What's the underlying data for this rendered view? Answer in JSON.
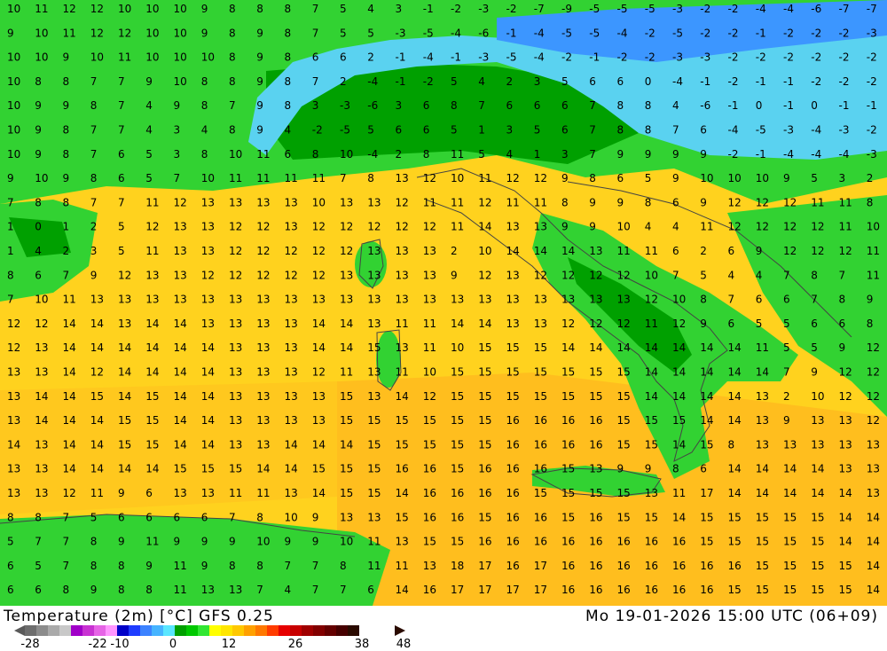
{
  "footer": {
    "title": "Temperature (2m) [°C] GFS 0.25",
    "datetime": "Mo 19-01-2026 15:00 UTC (06+09)",
    "scale_ticks": [
      "-28",
      "-22",
      "-10",
      "0",
      "12",
      "26",
      "38",
      "48"
    ],
    "scale_colors": [
      "#6e6e6e",
      "#8c8c8c",
      "#aaaaaa",
      "#c8c8c8",
      "#a000c8",
      "#c832d2",
      "#e664e6",
      "#ff96ff",
      "#0000c8",
      "#1e3cff",
      "#3c82ff",
      "#46b4ff",
      "#5ae6ff",
      "#00a000",
      "#00c800",
      "#32e632",
      "#ffff00",
      "#ffe600",
      "#ffc800",
      "#ffa000",
      "#ff7800",
      "#ff3c00",
      "#e60000",
      "#c80000",
      "#a00000",
      "#820000",
      "#640000",
      "#460000",
      "#2a0a00"
    ]
  },
  "map_values": [
    [
      "10",
      "11",
      "12",
      "12",
      "10",
      "10",
      "10",
      "9",
      "8",
      "8",
      "8",
      "7",
      "5",
      "4",
      "3",
      "-1",
      "-2",
      "-3",
      "-2",
      "-7",
      "-9",
      "-5",
      "-5",
      "-5",
      "-3",
      "-2",
      "-2",
      "-4",
      "-4",
      "-6",
      "-7",
      "-7"
    ],
    [
      "9",
      "10",
      "11",
      "12",
      "12",
      "10",
      "10",
      "9",
      "8",
      "9",
      "8",
      "7",
      "5",
      "5",
      "-3",
      "-5",
      "-4",
      "-6",
      "-1",
      "-4",
      "-5",
      "-5",
      "-4",
      "-2",
      "-5",
      "-2",
      "-2",
      "-1",
      "-2",
      "-2",
      "-2",
      "-3"
    ],
    [
      "10",
      "10",
      "9",
      "10",
      "11",
      "10",
      "10",
      "10",
      "8",
      "9",
      "8",
      "6",
      "6",
      "2",
      "-1",
      "-4",
      "-1",
      "-3",
      "-5",
      "-4",
      "-2",
      "-1",
      "-2",
      "-2",
      "-3",
      "-3",
      "-2",
      "-2",
      "-2",
      "-2",
      "-2",
      "-2"
    ],
    [
      "10",
      "8",
      "8",
      "7",
      "7",
      "9",
      "10",
      "8",
      "8",
      "9",
      "8",
      "7",
      "2",
      "-4",
      "-1",
      "-2",
      "5",
      "4",
      "2",
      "3",
      "5",
      "6",
      "6",
      "0",
      "-4",
      "-1",
      "-2",
      "-1",
      "-1",
      "-2",
      "-2",
      "-2"
    ],
    [
      "10",
      "9",
      "9",
      "8",
      "7",
      "4",
      "9",
      "8",
      "7",
      "9",
      "8",
      "3",
      "-3",
      "-6",
      "3",
      "6",
      "8",
      "7",
      "6",
      "6",
      "6",
      "7",
      "8",
      "8",
      "4",
      "-6",
      "-1",
      "0",
      "-1",
      "0",
      "-1",
      "-1"
    ],
    [
      "10",
      "9",
      "8",
      "7",
      "7",
      "4",
      "3",
      "4",
      "8",
      "9",
      "4",
      "-2",
      "-5",
      "5",
      "6",
      "6",
      "5",
      "1",
      "3",
      "5",
      "6",
      "7",
      "8",
      "8",
      "7",
      "6",
      "-4",
      "-5",
      "-3",
      "-4",
      "-3",
      "-2"
    ],
    [
      "10",
      "9",
      "8",
      "7",
      "6",
      "5",
      "3",
      "8",
      "10",
      "11",
      "6",
      "8",
      "10",
      "-4",
      "2",
      "8",
      "11",
      "5",
      "4",
      "1",
      "3",
      "7",
      "9",
      "9",
      "9",
      "9",
      "-2",
      "-1",
      "-4",
      "-4",
      "-4",
      "-3"
    ],
    [
      "9",
      "10",
      "9",
      "8",
      "6",
      "5",
      "7",
      "10",
      "11",
      "11",
      "11",
      "11",
      "7",
      "8",
      "13",
      "12",
      "10",
      "11",
      "12",
      "12",
      "9",
      "8",
      "6",
      "5",
      "9",
      "10",
      "10",
      "10",
      "9",
      "5",
      "3",
      "2"
    ],
    [
      "7",
      "8",
      "8",
      "7",
      "7",
      "11",
      "12",
      "13",
      "13",
      "13",
      "13",
      "10",
      "13",
      "13",
      "12",
      "11",
      "11",
      "12",
      "11",
      "11",
      "8",
      "9",
      "9",
      "8",
      "6",
      "9",
      "12",
      "12",
      "12",
      "11",
      "11",
      "8"
    ],
    [
      "1",
      "0",
      "1",
      "2",
      "5",
      "12",
      "13",
      "13",
      "12",
      "12",
      "13",
      "12",
      "12",
      "12",
      "12",
      "12",
      "11",
      "14",
      "13",
      "13",
      "9",
      "9",
      "10",
      "4",
      "4",
      "11",
      "12",
      "12",
      "12",
      "12",
      "11",
      "10"
    ],
    [
      "1",
      "4",
      "2",
      "3",
      "5",
      "11",
      "13",
      "13",
      "12",
      "12",
      "12",
      "12",
      "12",
      "13",
      "13",
      "13",
      "2",
      "10",
      "14",
      "14",
      "14",
      "13",
      "11",
      "11",
      "6",
      "2",
      "6",
      "9",
      "12",
      "12",
      "12",
      "11"
    ],
    [
      "8",
      "6",
      "7",
      "9",
      "12",
      "13",
      "13",
      "12",
      "12",
      "12",
      "12",
      "12",
      "13",
      "13",
      "13",
      "13",
      "9",
      "12",
      "13",
      "12",
      "12",
      "12",
      "12",
      "10",
      "7",
      "5",
      "4",
      "4",
      "7",
      "8",
      "7",
      "11"
    ],
    [
      "7",
      "10",
      "11",
      "13",
      "13",
      "13",
      "13",
      "13",
      "13",
      "13",
      "13",
      "13",
      "13",
      "13",
      "13",
      "13",
      "13",
      "13",
      "13",
      "13",
      "13",
      "13",
      "13",
      "12",
      "10",
      "8",
      "7",
      "6",
      "6",
      "7",
      "8",
      "9"
    ],
    [
      "12",
      "12",
      "14",
      "14",
      "13",
      "14",
      "14",
      "13",
      "13",
      "13",
      "13",
      "14",
      "14",
      "13",
      "11",
      "11",
      "14",
      "14",
      "13",
      "13",
      "12",
      "12",
      "12",
      "11",
      "12",
      "9",
      "6",
      "5",
      "5",
      "6",
      "6",
      "8"
    ],
    [
      "12",
      "13",
      "14",
      "14",
      "14",
      "14",
      "14",
      "14",
      "13",
      "13",
      "13",
      "14",
      "14",
      "15",
      "13",
      "11",
      "10",
      "15",
      "15",
      "15",
      "14",
      "14",
      "14",
      "14",
      "14",
      "14",
      "14",
      "11",
      "5",
      "5",
      "9",
      "12"
    ],
    [
      "13",
      "13",
      "14",
      "12",
      "14",
      "14",
      "14",
      "14",
      "13",
      "13",
      "13",
      "12",
      "11",
      "13",
      "11",
      "10",
      "15",
      "15",
      "15",
      "15",
      "15",
      "15",
      "15",
      "14",
      "14",
      "14",
      "14",
      "14",
      "7",
      "9",
      "12",
      "12"
    ],
    [
      "13",
      "14",
      "14",
      "15",
      "14",
      "15",
      "14",
      "14",
      "13",
      "13",
      "13",
      "13",
      "15",
      "13",
      "14",
      "12",
      "15",
      "15",
      "15",
      "15",
      "15",
      "15",
      "15",
      "14",
      "14",
      "14",
      "14",
      "13",
      "2",
      "10",
      "12",
      "12"
    ],
    [
      "13",
      "14",
      "14",
      "14",
      "15",
      "15",
      "14",
      "14",
      "13",
      "13",
      "13",
      "13",
      "15",
      "15",
      "15",
      "15",
      "15",
      "15",
      "16",
      "16",
      "16",
      "16",
      "15",
      "15",
      "15",
      "14",
      "14",
      "13",
      "9",
      "13",
      "13",
      "12"
    ],
    [
      "14",
      "13",
      "14",
      "14",
      "15",
      "15",
      "14",
      "14",
      "13",
      "13",
      "14",
      "14",
      "14",
      "15",
      "15",
      "15",
      "15",
      "15",
      "16",
      "16",
      "16",
      "16",
      "15",
      "15",
      "14",
      "15",
      "8",
      "13",
      "13",
      "13",
      "13",
      "13"
    ],
    [
      "13",
      "13",
      "14",
      "14",
      "14",
      "14",
      "15",
      "15",
      "15",
      "14",
      "14",
      "15",
      "15",
      "15",
      "16",
      "16",
      "15",
      "16",
      "16",
      "16",
      "15",
      "13",
      "9",
      "9",
      "8",
      "6",
      "14",
      "14",
      "14",
      "14",
      "13",
      "13"
    ],
    [
      "13",
      "13",
      "12",
      "11",
      "9",
      "6",
      "13",
      "13",
      "11",
      "11",
      "13",
      "14",
      "15",
      "15",
      "14",
      "16",
      "16",
      "16",
      "16",
      "15",
      "15",
      "15",
      "15",
      "13",
      "11",
      "17",
      "14",
      "14",
      "14",
      "14",
      "14",
      "13"
    ],
    [
      "8",
      "8",
      "7",
      "5",
      "6",
      "6",
      "6",
      "6",
      "7",
      "8",
      "10",
      "9",
      "13",
      "13",
      "15",
      "16",
      "16",
      "15",
      "16",
      "16",
      "15",
      "16",
      "15",
      "15",
      "14",
      "15",
      "15",
      "15",
      "15",
      "15",
      "14",
      "14"
    ],
    [
      "5",
      "7",
      "7",
      "8",
      "9",
      "11",
      "9",
      "9",
      "9",
      "10",
      "9",
      "9",
      "10",
      "11",
      "13",
      "15",
      "15",
      "16",
      "16",
      "16",
      "16",
      "16",
      "16",
      "16",
      "16",
      "15",
      "15",
      "15",
      "15",
      "15",
      "14",
      "14"
    ],
    [
      "6",
      "5",
      "7",
      "8",
      "8",
      "9",
      "11",
      "9",
      "8",
      "8",
      "7",
      "7",
      "8",
      "11",
      "11",
      "13",
      "18",
      "17",
      "16",
      "17",
      "16",
      "16",
      "16",
      "16",
      "16",
      "16",
      "16",
      "15",
      "15",
      "15",
      "15",
      "14"
    ],
    [
      "6",
      "6",
      "8",
      "9",
      "8",
      "8",
      "11",
      "13",
      "13",
      "7",
      "4",
      "7",
      "7",
      "6",
      "14",
      "16",
      "17",
      "17",
      "17",
      "17",
      "16",
      "16",
      "16",
      "16",
      "16",
      "16",
      "15",
      "15",
      "15",
      "15",
      "15",
      "14"
    ]
  ]
}
